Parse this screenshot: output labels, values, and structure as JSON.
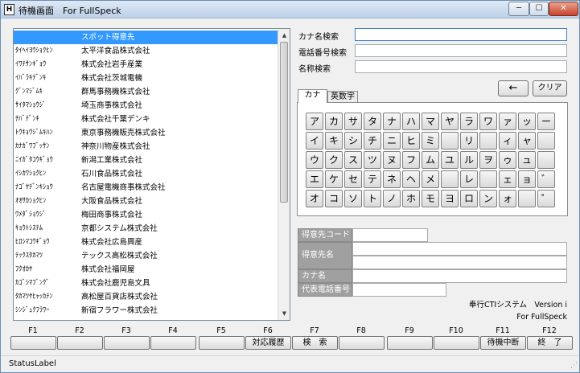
{
  "window": {
    "title": "待機画面　For FullSpeck",
    "icon_glyph": "H",
    "minimize_glyph": "─",
    "maximize_glyph": "☐",
    "close_glyph": "✕"
  },
  "customer_list": {
    "scroll_up_glyph": "▲",
    "scroll_down_glyph": "▼",
    "rows": [
      {
        "kana": "",
        "name": "スポット得意先",
        "selected": true
      },
      {
        "kana": "ﾀｲﾍｲﾖｳｼｮｸﾋﾝ",
        "name": "太平洋食品株式会社"
      },
      {
        "kana": "ｲﾜﾃｻﾝｷﾞｮｳ",
        "name": "株式会社岩手産業"
      },
      {
        "kana": "ｲﾊﾞﾗｷﾃﾞﾝｷ",
        "name": "株式会社茨城電機"
      },
      {
        "kana": "ｸﾞﾝﾏｼﾞﾑｷ",
        "name": "群馬事務機株式会社"
      },
      {
        "kana": "ｻｲﾀﾏｼｮｳｼﾞ",
        "name": "埼玉商事株式会社"
      },
      {
        "kana": "ﾁﾊﾞﾃﾞﾝｷ",
        "name": "株式会社千葉デンキ"
      },
      {
        "kana": "ﾄｳｷｮｳｼﾞﾑｷﾊﾝ",
        "name": "東京事務機販売株式会社"
      },
      {
        "kana": "ｶﾅｶﾞﾜﾌﾞｯｻﾝ",
        "name": "神奈川物産株式会社"
      },
      {
        "kana": "ﾆｲｶﾞﾀｺｳｷﾞｮｳ",
        "name": "新潟工業株式会社"
      },
      {
        "kana": "ｲｼｶﾜｼｮｸﾋﾝ",
        "name": "石川食品株式会社"
      },
      {
        "kana": "ﾅｺﾞﾔﾃﾞﾝｷｼｮｳ",
        "name": "名古屋電機商事株式会社"
      },
      {
        "kana": "ｵｵｻｶｼｮｸﾋﾝ",
        "name": "大阪食品株式会社"
      },
      {
        "kana": "ｳﾒﾀﾞｼｮｳｼﾞ",
        "name": "梅田商事株式会社"
      },
      {
        "kana": "ｷｮｳﾄｼｽﾃﾑ",
        "name": "京都システム株式会社"
      },
      {
        "kana": "ﾋﾛｼﾏｺｳｷﾞｮｳ",
        "name": "株式会社広島興産"
      },
      {
        "kana": "ﾃｯｸｽﾀｶﾏﾂ",
        "name": "テックス高松株式会社"
      },
      {
        "kana": "ﾌｸｵｶﾔ",
        "name": "株式会社福岡屋"
      },
      {
        "kana": "ｶｺﾞｼﾏﾌﾞﾝｸﾞ",
        "name": "株式会社鹿児島文具"
      },
      {
        "kana": "ﾀｶﾏﾂﾔﾋｬｯｶﾃﾝ",
        "name": "高松屋百貨店株式会社"
      },
      {
        "kana": "ｼﾝｼﾞｭｸﾌﾗﾜｰ",
        "name": "新宿フラワー株式会社"
      }
    ]
  },
  "search": {
    "kana_label": "カナ名検索",
    "kana_value": "",
    "phone_label": "電話番号検索",
    "phone_value": "",
    "name_label": "名称検索",
    "name_value": ""
  },
  "buttons": {
    "back": "←",
    "clear": "クリア"
  },
  "tabs": [
    {
      "label": "カナ",
      "active": true
    },
    {
      "label": "英数字",
      "active": false
    }
  ],
  "keyboard": {
    "rows": [
      [
        "ア",
        "カ",
        "サ",
        "タ",
        "ナ",
        "ハ",
        "マ",
        "ヤ",
        "ラ",
        "ワ",
        "ァ",
        "ッ",
        "ー"
      ],
      [
        "イ",
        "キ",
        "シ",
        "チ",
        "ニ",
        "ヒ",
        "ミ",
        "",
        "リ",
        "",
        "ィ",
        "ャ",
        ""
      ],
      [
        "ウ",
        "ク",
        "ス",
        "ツ",
        "ヌ",
        "フ",
        "ム",
        "ユ",
        "ル",
        "ヲ",
        "ゥ",
        "ュ",
        ""
      ],
      [
        "エ",
        "ケ",
        "セ",
        "テ",
        "ネ",
        "ヘ",
        "メ",
        "",
        "レ",
        "",
        "ェ",
        "ョ",
        "゛"
      ],
      [
        "オ",
        "コ",
        "ソ",
        "ト",
        "ノ",
        "ホ",
        "モ",
        "ヨ",
        "ロ",
        "ン",
        "ォ",
        "",
        "゜"
      ]
    ]
  },
  "customer_info": {
    "code_label": "得意先コード",
    "code_value": "",
    "name_label": "得意先名",
    "name_value_1": "",
    "name_value_2": "",
    "kana_label": "カナ名",
    "kana_value": "",
    "phone_label": "代表電話番号",
    "phone_value": ""
  },
  "version": {
    "system": "奉行CTIシステム　Version i",
    "for": "For FullSpeck"
  },
  "function_keys": [
    {
      "key": "F1",
      "label": ""
    },
    {
      "key": "F2",
      "label": ""
    },
    {
      "key": "F3",
      "label": ""
    },
    {
      "key": "F4",
      "label": ""
    },
    {
      "key": "F5",
      "label": ""
    },
    {
      "key": "F6",
      "label": "対応履歴"
    },
    {
      "key": "F7",
      "label": "検　索"
    },
    {
      "key": "F8",
      "label": ""
    },
    {
      "key": "F9",
      "label": ""
    },
    {
      "key": "F10",
      "label": ""
    },
    {
      "key": "F11",
      "label": "待機中断"
    },
    {
      "key": "F12",
      "label": "終　了"
    }
  ],
  "status": {
    "label": "StatusLabel",
    "grip_glyph": "⋰"
  }
}
